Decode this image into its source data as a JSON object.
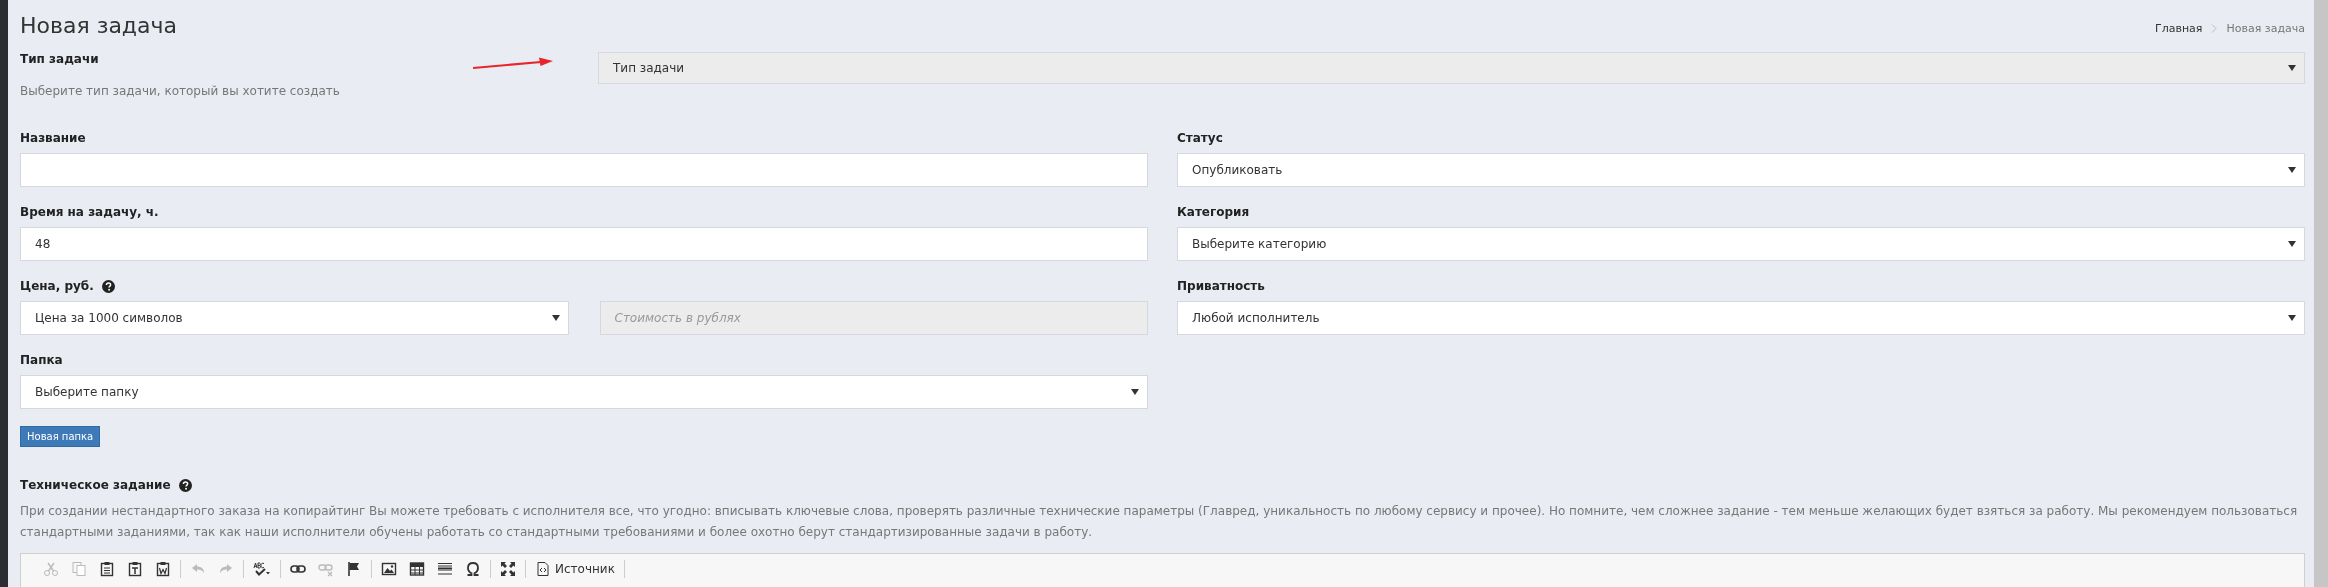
{
  "page_title": "Новая задача",
  "breadcrumbs": [
    {
      "label": "Главная",
      "current": false
    },
    {
      "label": "Новая задача",
      "current": true
    }
  ],
  "task_type": {
    "label": "Тип задачи",
    "hint": "Выберите тип задачи, который вы хотите создать",
    "value": "Тип задачи",
    "disabled": true
  },
  "left_fields": [
    {
      "kind": "text",
      "label": "Название",
      "help": false
    },
    {
      "kind": "text",
      "label": "Время на задачу, ч.",
      "help": false,
      "value": "48"
    },
    {
      "kind": "price",
      "label": "Цена, руб.",
      "help": true,
      "value": "Цена за 1000 символов",
      "amount_placeholder": "Стоимость в рублях",
      "amount_disabled": true
    },
    {
      "kind": "select",
      "label": "Папка",
      "help": false,
      "value": "Выберите папку"
    }
  ],
  "new_folder_button": "Новая папка",
  "right_fields": [
    {
      "kind": "select",
      "label": "Статус",
      "help": false,
      "value": "Опубликовать"
    },
    {
      "kind": "select",
      "label": "Категория",
      "help": false,
      "value": "Выберите категорию"
    },
    {
      "kind": "select",
      "label": "Приватность",
      "help": false,
      "value": "Любой исполнитель"
    }
  ],
  "spec": {
    "label": "Техническое задание",
    "help": true,
    "description": "При создании нестандартного заказа на копирайтинг Вы можете требовать с исполнителя все, что угодно: вписывать ключевые слова, проверять различные технические параметры (Главред, уникальность по любому сервису и прочее). Но помните, чем сложнее задание - тем меньше желающих будет взяться за работу. Мы рекомендуем пользоваться стандартными заданиями, так как наши исполнители обучены работать со стандартными требованиями и более охотно берут стандартизированные задачи в работу.",
    "toolbar": [
      {
        "kind": "cut",
        "disabled": true
      },
      {
        "kind": "copy",
        "disabled": true
      },
      {
        "kind": "paste",
        "disabled": false
      },
      {
        "kind": "paste-text",
        "disabled": false
      },
      {
        "kind": "paste-word",
        "disabled": false
      },
      {
        "kind": "separator"
      },
      {
        "kind": "undo",
        "disabled": true
      },
      {
        "kind": "redo",
        "disabled": true
      },
      {
        "kind": "separator"
      },
      {
        "kind": "spellcheck",
        "disabled": false
      },
      {
        "kind": "separator"
      },
      {
        "kind": "link",
        "disabled": false
      },
      {
        "kind": "unlink",
        "disabled": true
      },
      {
        "kind": "anchor",
        "disabled": false
      },
      {
        "kind": "separator"
      },
      {
        "kind": "image",
        "disabled": false
      },
      {
        "kind": "table",
        "disabled": false
      },
      {
        "kind": "hline",
        "disabled": false
      },
      {
        "kind": "special-char",
        "disabled": false
      },
      {
        "kind": "separator"
      },
      {
        "kind": "maximize",
        "disabled": false
      },
      {
        "kind": "separator"
      },
      {
        "kind": "source",
        "disabled": false,
        "label": "Источник"
      },
      {
        "kind": "separator"
      }
    ]
  }
}
